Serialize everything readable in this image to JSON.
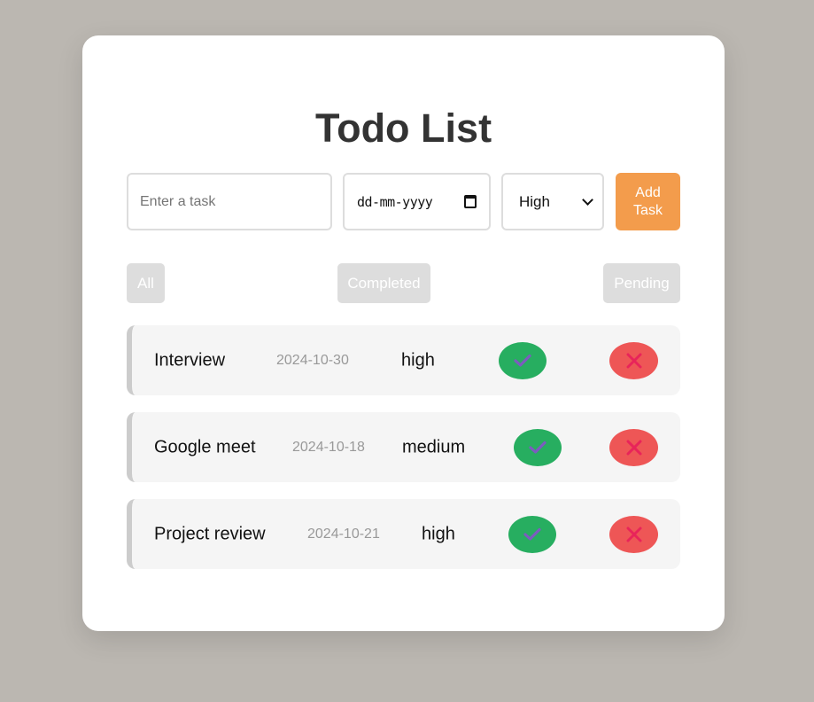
{
  "page": {
    "title": "Todo List"
  },
  "form": {
    "task_placeholder": "Enter a task",
    "date_placeholder": "dd-mm-yyyy",
    "priority_selected": "High",
    "add_button_label": "Add Task"
  },
  "filters": [
    {
      "label": "All"
    },
    {
      "label": "Completed"
    },
    {
      "label": "Pending"
    }
  ],
  "tasks": [
    {
      "name": "Interview",
      "date": "2024-10-30",
      "priority": "high"
    },
    {
      "name": "Google meet",
      "date": "2024-10-18",
      "priority": "medium"
    },
    {
      "name": "Project review",
      "date": "2024-10-21",
      "priority": "high"
    }
  ],
  "icons": {
    "complete": "check-icon",
    "delete": "close-icon",
    "date": "calendar-icon",
    "select": "chevron-down-icon"
  },
  "colors": {
    "background": "#bbb7b1",
    "card": "#ffffff",
    "accent": "#f39c4c",
    "complete": "#27ae60",
    "delete": "#ee5656",
    "check_glyph": "#7c5cbf",
    "x_glyph": "#e8245a",
    "filter": "#dddddd"
  }
}
